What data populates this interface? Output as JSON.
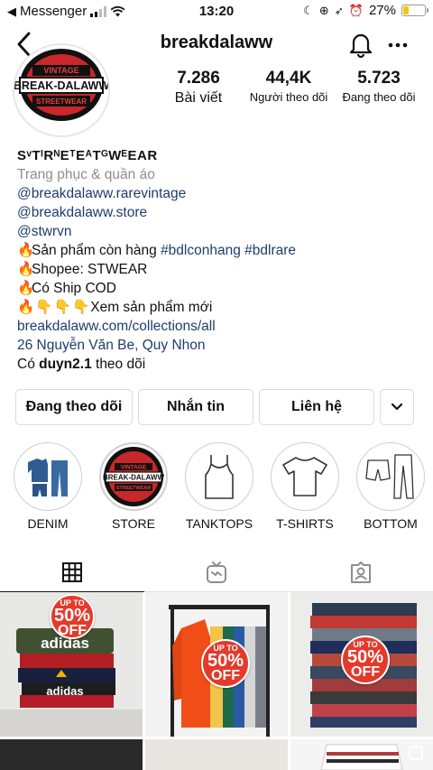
{
  "status_bar": {
    "carrier": "Messenger",
    "time": "13:20",
    "battery": "27%",
    "battery_level": 0.27,
    "battery_color": "#f7c600"
  },
  "header": {
    "username": "breakdalaww",
    "back_icon": "chevron-left-icon",
    "bell_icon": "bell-icon",
    "more_icon": "more-horizontal-icon"
  },
  "profile": {
    "avatar_text": {
      "top": "VINTAGE",
      "middle": "BREAK-DALAWW",
      "bottom": "STREETWEAR"
    },
    "stats": [
      {
        "value": "7.286",
        "label": "Bài viết"
      },
      {
        "value": "44,4K",
        "label": "Người theo dõi"
      },
      {
        "value": "5.723",
        "label": "Đang theo dõi"
      }
    ]
  },
  "bio": {
    "name": "SᵛTᴵRᴺEᵀEᴬTᴳWᴱEAR",
    "category": "Trang phục & quần áo",
    "mention1": "@breakdalaww.rarevintage",
    "mention2": "@breakdalaww.store",
    "mention3": "@stwrvn",
    "line1_text": "Sản phẩm còn hàng ",
    "line1_tag1": "#bdlconhang",
    "line1_tag2": "#bdlrare",
    "line2_text": "Shopee: STWEAR",
    "line3_text": "Có Ship COD",
    "line4_text": "Xem sản phẩm mới",
    "website": "breakdalaww.com/collections/all",
    "address": "26 Nguyễn Văn Be, Quy Nhon",
    "followed_prefix": "Có ",
    "followed_by": "duyn2.1",
    "followed_suffix": " theo dõi"
  },
  "buttons": {
    "following": "Đang theo dõi",
    "message": "Nhắn tin",
    "contact": "Liên hệ",
    "dropdown_icon": "chevron-down-icon"
  },
  "highlights": [
    {
      "label": "DENIM",
      "icon": "denim-icon"
    },
    {
      "label": "STORE",
      "icon": "store-logo-icon"
    },
    {
      "label": "TANKTOPS",
      "icon": "tanktop-icon"
    },
    {
      "label": "T-SHIRTS",
      "icon": "tshirt-icon"
    },
    {
      "label": "BOTTOM",
      "icon": "bottom-icon"
    }
  ],
  "tabs": [
    {
      "name": "grid",
      "icon": "grid-icon"
    },
    {
      "name": "igtv",
      "icon": "igtv-icon"
    },
    {
      "name": "tagged",
      "icon": "tagged-person-icon"
    }
  ],
  "posts": [
    {
      "sale_top": "UP TO",
      "sale_pct": "50%",
      "sale_off": "OFF",
      "brand": "adidas"
    },
    {
      "sale_top": "UP TO",
      "sale_pct": "50%",
      "sale_off": "OFF"
    },
    {
      "sale_top": "UP TO",
      "sale_pct": "50%",
      "sale_off": "OFF"
    }
  ],
  "colors": {
    "link": "#1f3d6b",
    "muted": "#8e8e8e",
    "sale_red": "#e43a2b"
  }
}
